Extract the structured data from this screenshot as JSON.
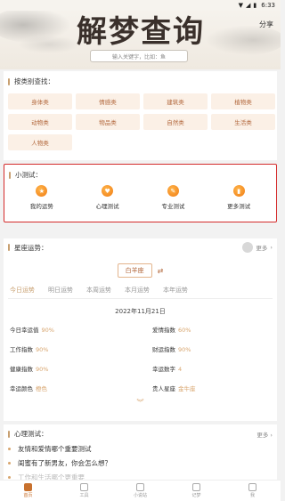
{
  "status_bar": {
    "time": "6:33",
    "icons": [
      "wifi-icon",
      "signal-icon",
      "battery-icon"
    ]
  },
  "header": {
    "title": "解梦查询",
    "share": "分享",
    "search_placeholder": "输入关键字，比如：鱼"
  },
  "categories": {
    "title": "按类别查找：",
    "items": [
      "身体类",
      "情感类",
      "建筑类",
      "植物类",
      "动物类",
      "物品类",
      "自然类",
      "生活类",
      "人物类"
    ]
  },
  "tests": {
    "title": "小测试：",
    "items": [
      {
        "label": "我的运势",
        "icon": "fortune-icon"
      },
      {
        "label": "心理测试",
        "icon": "heart-icon"
      },
      {
        "label": "专业测试",
        "icon": "professional-icon"
      },
      {
        "label": "更多测试",
        "icon": "more-tests-icon"
      }
    ]
  },
  "fortune": {
    "title": "星座运势：",
    "more": "更多",
    "sign": "白羊座",
    "tabs": [
      "今日运势",
      "明日运势",
      "本周运势",
      "本月运势",
      "本年运势"
    ],
    "active_tab": 0,
    "date": "2022年11月21日",
    "stats": [
      {
        "label": "今日幸运值",
        "value": "90%"
      },
      {
        "label": "爱情指数",
        "value": "60%"
      },
      {
        "label": "工作指数",
        "value": "90%"
      },
      {
        "label": "财运指数",
        "value": "90%"
      },
      {
        "label": "健康指数",
        "value": "90%"
      },
      {
        "label": "幸运数字",
        "value": "4"
      },
      {
        "label": "幸运颜色",
        "value": "橙色"
      },
      {
        "label": "贵人星座",
        "value": "金牛座"
      }
    ]
  },
  "psych": {
    "title": "心理测试：",
    "more": "更多",
    "questions": [
      "友情和爱情哪个重要测试",
      "闺蜜有了新男友，你会怎么想？",
      "工作和生活哪个更重要"
    ]
  },
  "tabbar": {
    "items": [
      {
        "label": "首页",
        "icon": "home-icon"
      },
      {
        "label": "工具",
        "icon": "tools-icon"
      },
      {
        "label": "小说站",
        "icon": "book-icon"
      },
      {
        "label": "记梦",
        "icon": "dream-icon"
      },
      {
        "label": "我",
        "icon": "user-icon"
      }
    ],
    "active": 0
  },
  "colors": {
    "accent": "#c8a071",
    "highlight_border": "#d42b2b",
    "category_bg": "#fbf0e6",
    "category_text": "#b3693e"
  }
}
